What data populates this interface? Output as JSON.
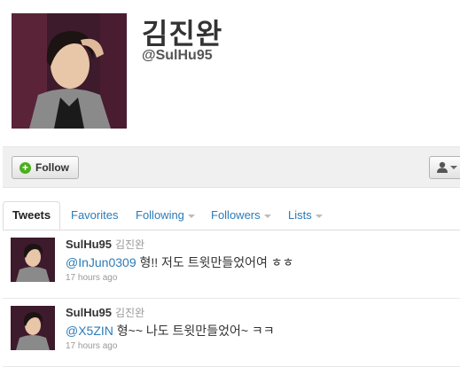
{
  "profile": {
    "name": "김진완",
    "handle": "@SulHu95"
  },
  "actions": {
    "follow_label": "Follow"
  },
  "tabs": [
    {
      "label": "Tweets",
      "active": true,
      "has_menu": false
    },
    {
      "label": "Favorites",
      "active": false,
      "has_menu": false
    },
    {
      "label": "Following",
      "active": false,
      "has_menu": true
    },
    {
      "label": "Followers",
      "active": false,
      "has_menu": true
    },
    {
      "label": "Lists",
      "active": false,
      "has_menu": true
    }
  ],
  "tweets": [
    {
      "username": "SulHu95",
      "fullname": "김진완",
      "mention": "@InJun0309",
      "text": " 형!! 저도 트윗만들었어여 ㅎㅎ",
      "time": "17 hours ago"
    },
    {
      "username": "SulHu95",
      "fullname": "김진완",
      "mention": "@X5ZIN",
      "text": " 형~~ 나도 트윗만들었어~ ㅋㅋ",
      "time": "17 hours ago"
    }
  ],
  "colors": {
    "link": "#2b7bb9",
    "follow_icon": "#4caf1e"
  },
  "icons": {
    "follow": "plus-circle-icon",
    "user_menu": "person-icon"
  }
}
